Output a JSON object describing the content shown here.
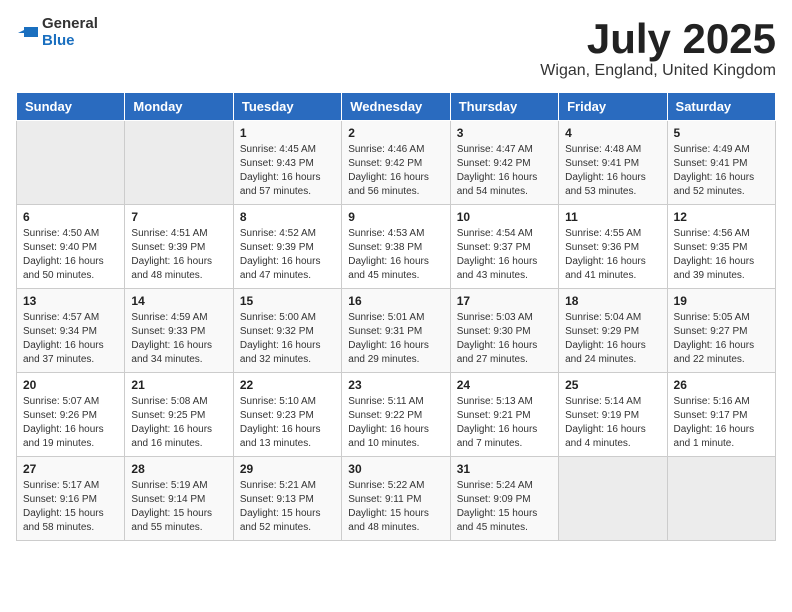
{
  "header": {
    "logo_general": "General",
    "logo_blue": "Blue",
    "month": "July 2025",
    "location": "Wigan, England, United Kingdom"
  },
  "weekdays": [
    "Sunday",
    "Monday",
    "Tuesday",
    "Wednesday",
    "Thursday",
    "Friday",
    "Saturday"
  ],
  "weeks": [
    [
      {
        "day": "",
        "empty": true
      },
      {
        "day": "",
        "empty": true
      },
      {
        "day": "1",
        "sunrise": "4:45 AM",
        "sunset": "9:43 PM",
        "daylight": "16 hours and 57 minutes."
      },
      {
        "day": "2",
        "sunrise": "4:46 AM",
        "sunset": "9:42 PM",
        "daylight": "16 hours and 56 minutes."
      },
      {
        "day": "3",
        "sunrise": "4:47 AM",
        "sunset": "9:42 PM",
        "daylight": "16 hours and 54 minutes."
      },
      {
        "day": "4",
        "sunrise": "4:48 AM",
        "sunset": "9:41 PM",
        "daylight": "16 hours and 53 minutes."
      },
      {
        "day": "5",
        "sunrise": "4:49 AM",
        "sunset": "9:41 PM",
        "daylight": "16 hours and 52 minutes."
      }
    ],
    [
      {
        "day": "6",
        "sunrise": "4:50 AM",
        "sunset": "9:40 PM",
        "daylight": "16 hours and 50 minutes."
      },
      {
        "day": "7",
        "sunrise": "4:51 AM",
        "sunset": "9:39 PM",
        "daylight": "16 hours and 48 minutes."
      },
      {
        "day": "8",
        "sunrise": "4:52 AM",
        "sunset": "9:39 PM",
        "daylight": "16 hours and 47 minutes."
      },
      {
        "day": "9",
        "sunrise": "4:53 AM",
        "sunset": "9:38 PM",
        "daylight": "16 hours and 45 minutes."
      },
      {
        "day": "10",
        "sunrise": "4:54 AM",
        "sunset": "9:37 PM",
        "daylight": "16 hours and 43 minutes."
      },
      {
        "day": "11",
        "sunrise": "4:55 AM",
        "sunset": "9:36 PM",
        "daylight": "16 hours and 41 minutes."
      },
      {
        "day": "12",
        "sunrise": "4:56 AM",
        "sunset": "9:35 PM",
        "daylight": "16 hours and 39 minutes."
      }
    ],
    [
      {
        "day": "13",
        "sunrise": "4:57 AM",
        "sunset": "9:34 PM",
        "daylight": "16 hours and 37 minutes."
      },
      {
        "day": "14",
        "sunrise": "4:59 AM",
        "sunset": "9:33 PM",
        "daylight": "16 hours and 34 minutes."
      },
      {
        "day": "15",
        "sunrise": "5:00 AM",
        "sunset": "9:32 PM",
        "daylight": "16 hours and 32 minutes."
      },
      {
        "day": "16",
        "sunrise": "5:01 AM",
        "sunset": "9:31 PM",
        "daylight": "16 hours and 29 minutes."
      },
      {
        "day": "17",
        "sunrise": "5:03 AM",
        "sunset": "9:30 PM",
        "daylight": "16 hours and 27 minutes."
      },
      {
        "day": "18",
        "sunrise": "5:04 AM",
        "sunset": "9:29 PM",
        "daylight": "16 hours and 24 minutes."
      },
      {
        "day": "19",
        "sunrise": "5:05 AM",
        "sunset": "9:27 PM",
        "daylight": "16 hours and 22 minutes."
      }
    ],
    [
      {
        "day": "20",
        "sunrise": "5:07 AM",
        "sunset": "9:26 PM",
        "daylight": "16 hours and 19 minutes."
      },
      {
        "day": "21",
        "sunrise": "5:08 AM",
        "sunset": "9:25 PM",
        "daylight": "16 hours and 16 minutes."
      },
      {
        "day": "22",
        "sunrise": "5:10 AM",
        "sunset": "9:23 PM",
        "daylight": "16 hours and 13 minutes."
      },
      {
        "day": "23",
        "sunrise": "5:11 AM",
        "sunset": "9:22 PM",
        "daylight": "16 hours and 10 minutes."
      },
      {
        "day": "24",
        "sunrise": "5:13 AM",
        "sunset": "9:21 PM",
        "daylight": "16 hours and 7 minutes."
      },
      {
        "day": "25",
        "sunrise": "5:14 AM",
        "sunset": "9:19 PM",
        "daylight": "16 hours and 4 minutes."
      },
      {
        "day": "26",
        "sunrise": "5:16 AM",
        "sunset": "9:17 PM",
        "daylight": "16 hours and 1 minute."
      }
    ],
    [
      {
        "day": "27",
        "sunrise": "5:17 AM",
        "sunset": "9:16 PM",
        "daylight": "15 hours and 58 minutes."
      },
      {
        "day": "28",
        "sunrise": "5:19 AM",
        "sunset": "9:14 PM",
        "daylight": "15 hours and 55 minutes."
      },
      {
        "day": "29",
        "sunrise": "5:21 AM",
        "sunset": "9:13 PM",
        "daylight": "15 hours and 52 minutes."
      },
      {
        "day": "30",
        "sunrise": "5:22 AM",
        "sunset": "9:11 PM",
        "daylight": "15 hours and 48 minutes."
      },
      {
        "day": "31",
        "sunrise": "5:24 AM",
        "sunset": "9:09 PM",
        "daylight": "15 hours and 45 minutes."
      },
      {
        "day": "",
        "empty": true
      },
      {
        "day": "",
        "empty": true
      }
    ]
  ]
}
